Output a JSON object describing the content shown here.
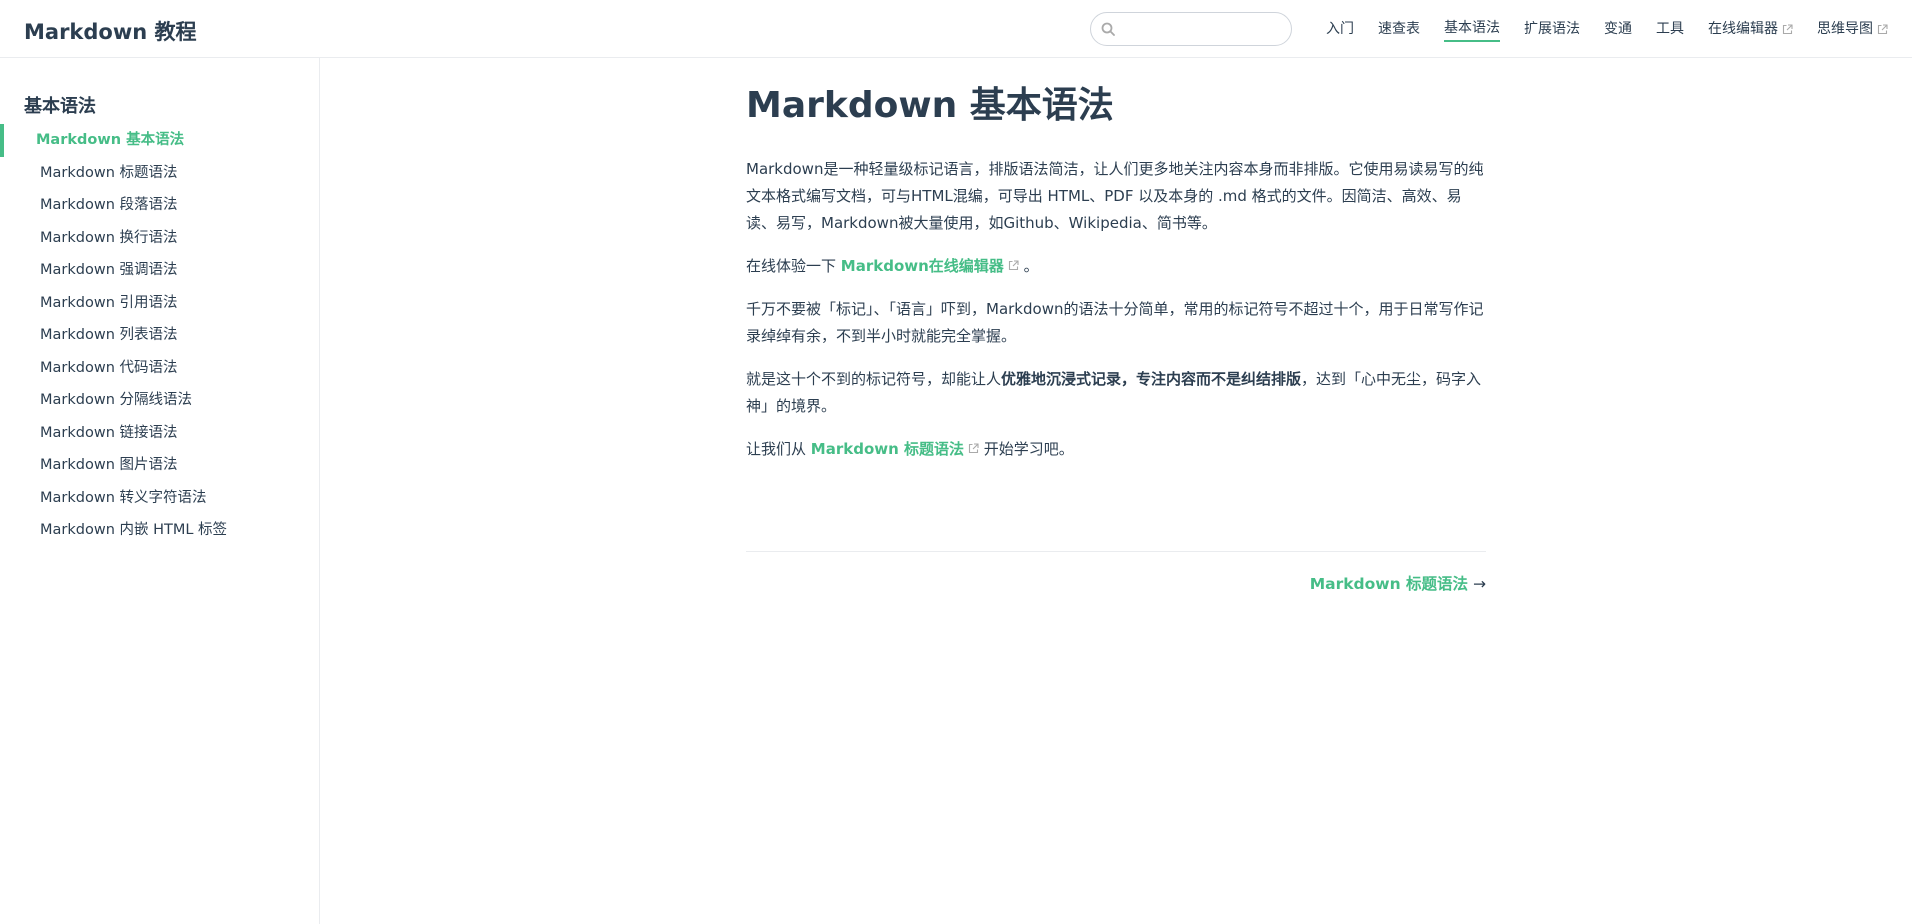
{
  "header": {
    "site_title": "Markdown 教程",
    "search_placeholder": "",
    "nav": [
      {
        "label": "入门"
      },
      {
        "label": "速查表"
      },
      {
        "label": "基本语法"
      },
      {
        "label": "扩展语法"
      },
      {
        "label": "变通"
      },
      {
        "label": "工具"
      },
      {
        "label": "在线编辑器"
      },
      {
        "label": "思维导图"
      }
    ]
  },
  "sidebar": {
    "heading": "基本语法",
    "items": [
      {
        "label": "Markdown 基本语法"
      },
      {
        "label": "Markdown 标题语法"
      },
      {
        "label": "Markdown 段落语法"
      },
      {
        "label": "Markdown 换行语法"
      },
      {
        "label": "Markdown 强调语法"
      },
      {
        "label": "Markdown 引用语法"
      },
      {
        "label": "Markdown 列表语法"
      },
      {
        "label": "Markdown 代码语法"
      },
      {
        "label": "Markdown 分隔线语法"
      },
      {
        "label": "Markdown 链接语法"
      },
      {
        "label": "Markdown 图片语法"
      },
      {
        "label": "Markdown 转义字符语法"
      },
      {
        "label": "Markdown 内嵌 HTML 标签"
      }
    ]
  },
  "main": {
    "title": "Markdown 基本语法",
    "p1": "Markdown是一种轻量级标记语言，排版语法简洁，让人们更多地关注内容本身而非排版。它使用易读易写的纯文本格式编写文档，可与HTML混编，可导出 HTML、PDF 以及本身的 .md 格式的文件。因简洁、高效、易读、易写，Markdown被大量使用，如Github、Wikipedia、简书等。",
    "p2_prefix": "在线体验一下 ",
    "p2_link": "Markdown在线编辑器",
    "p2_suffix": " 。",
    "p3": "千万不要被「标记」、「语言」吓到，Markdown的语法十分简单，常用的标记符号不超过十个，用于日常写作记录绰绰有余，不到半小时就能完全掌握。",
    "p4_prefix": "就是这十个不到的标记符号，却能让人",
    "p4_strong": "优雅地沉浸式记录，专注内容而不是纠结排版",
    "p4_suffix": "，达到「心中无尘，码字入神」的境界。",
    "p5_prefix": "让我们从 ",
    "p5_link": "Markdown 标题语法",
    "p5_suffix": " 开始学习吧。",
    "next_link": "Markdown 标题语法",
    "next_arrow": "→"
  }
}
